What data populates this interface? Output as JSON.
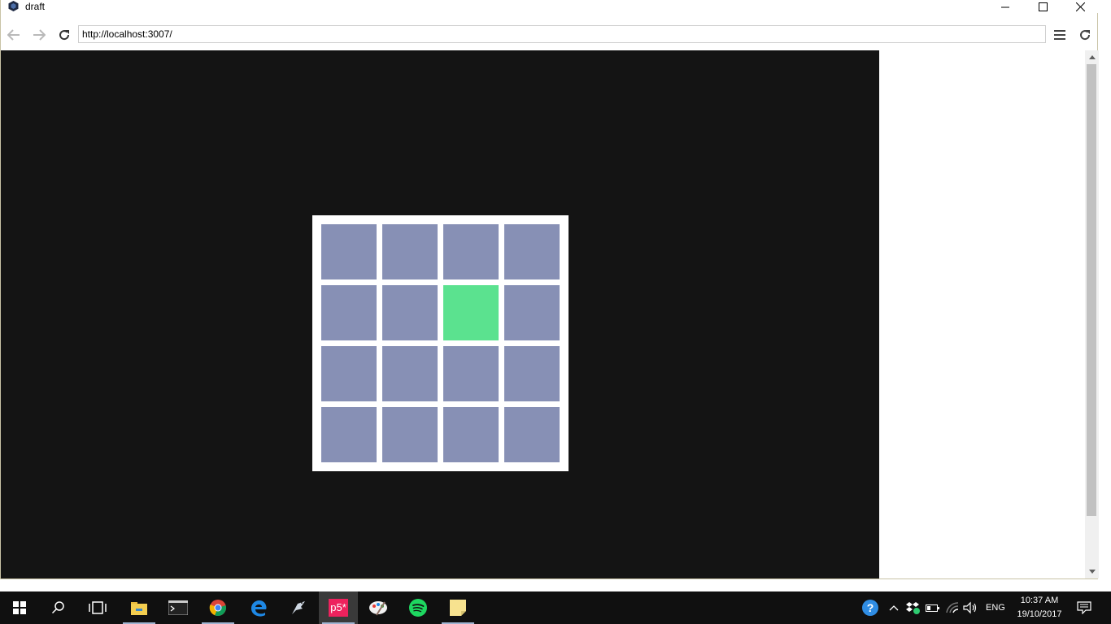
{
  "window": {
    "title": "draft",
    "minimize_icon": "minimize-icon",
    "maximize_icon": "maximize-icon",
    "close_icon": "close-icon"
  },
  "toolbar": {
    "back_icon": "arrow-left-icon",
    "forward_icon": "arrow-right-icon",
    "reload_icon": "reload-icon",
    "url": "http://localhost:3007/",
    "menu_icon": "hamburger-menu-icon",
    "refresh_icon": "refresh-icon"
  },
  "canvas": {
    "background": "#141414",
    "board_background": "#ffffff",
    "grid": {
      "rows": 4,
      "cols": 4,
      "cell_color": "#8790b5",
      "active_color": "#5be28f",
      "active_cell": {
        "row": 1,
        "col": 2
      }
    }
  },
  "taskbar": {
    "apps": [
      "start",
      "search",
      "task-view",
      "file-explorer",
      "terminal",
      "chrome",
      "edge",
      "app-bird",
      "p5",
      "paint",
      "spotify",
      "sticky-notes"
    ],
    "p5_label": "p5*",
    "language": "ENG",
    "time": "10:37 AM",
    "date": "19/10/2017"
  }
}
